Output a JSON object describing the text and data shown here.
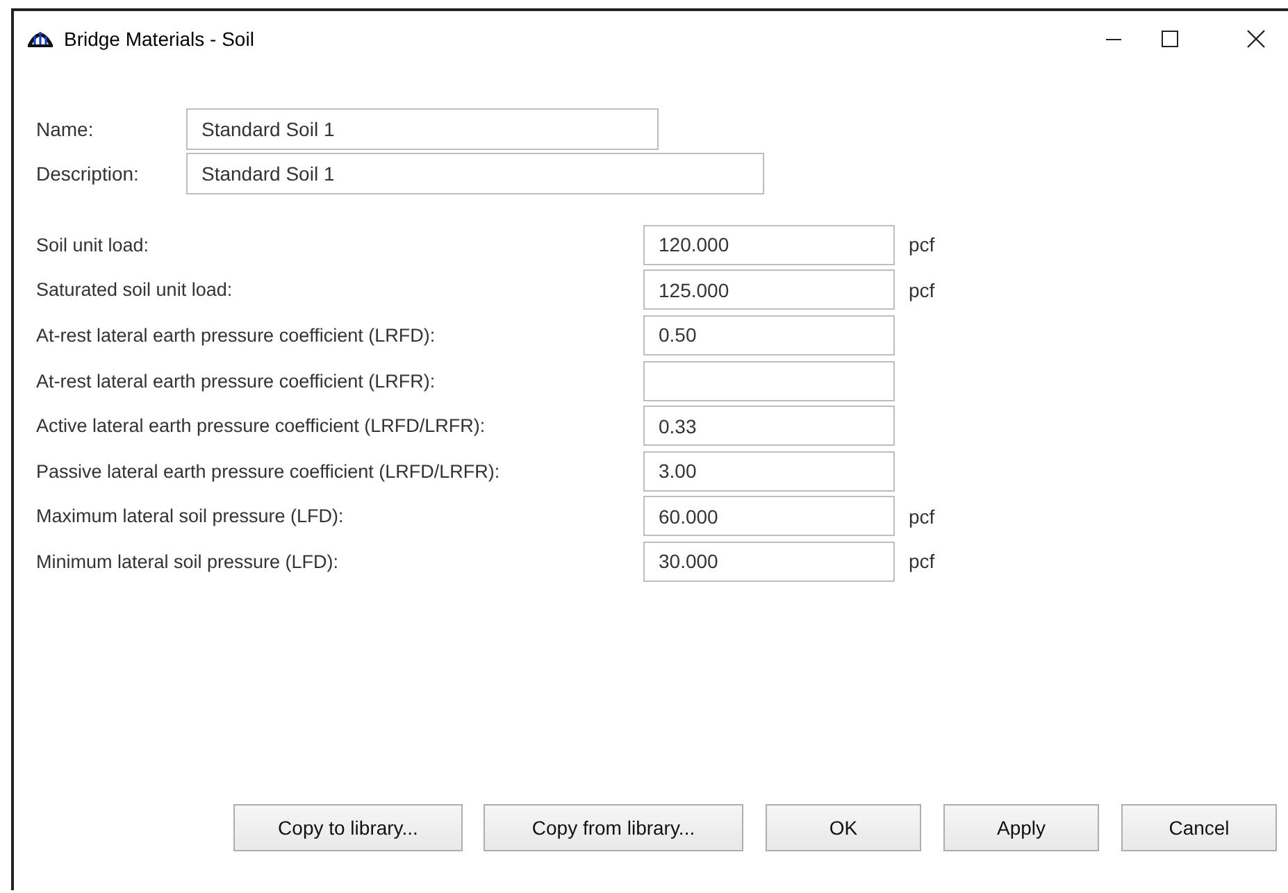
{
  "window": {
    "title": "Bridge Materials - Soil"
  },
  "name": {
    "label": "Name:",
    "value": "Standard Soil 1"
  },
  "description": {
    "label": "Description:",
    "value": "Standard Soil 1"
  },
  "properties": [
    {
      "label": "Soil unit load:",
      "value": "120.000",
      "unit": "pcf"
    },
    {
      "label": "Saturated soil unit load:",
      "value": "125.000",
      "unit": "pcf"
    },
    {
      "label": "At-rest lateral earth pressure coefficient (LRFD):",
      "value": "0.50"
    },
    {
      "label": "At-rest lateral earth pressure coefficient (LRFR):"
    },
    {
      "label": "Active lateral earth pressure coefficient (LRFD/LRFR):",
      "value": "0.33"
    },
    {
      "label": "Passive lateral earth pressure coefficient (LRFD/LRFR):",
      "value": "3.00"
    },
    {
      "label": "Maximum lateral soil pressure (LFD):",
      "value": "60.000",
      "unit": "pcf"
    },
    {
      "label": "Minimum lateral soil pressure (LFD):",
      "value": "30.000",
      "unit": "pcf"
    }
  ],
  "buttons": [
    "Copy to library...",
    "Copy from library...",
    "OK",
    "Apply",
    "Cancel"
  ]
}
